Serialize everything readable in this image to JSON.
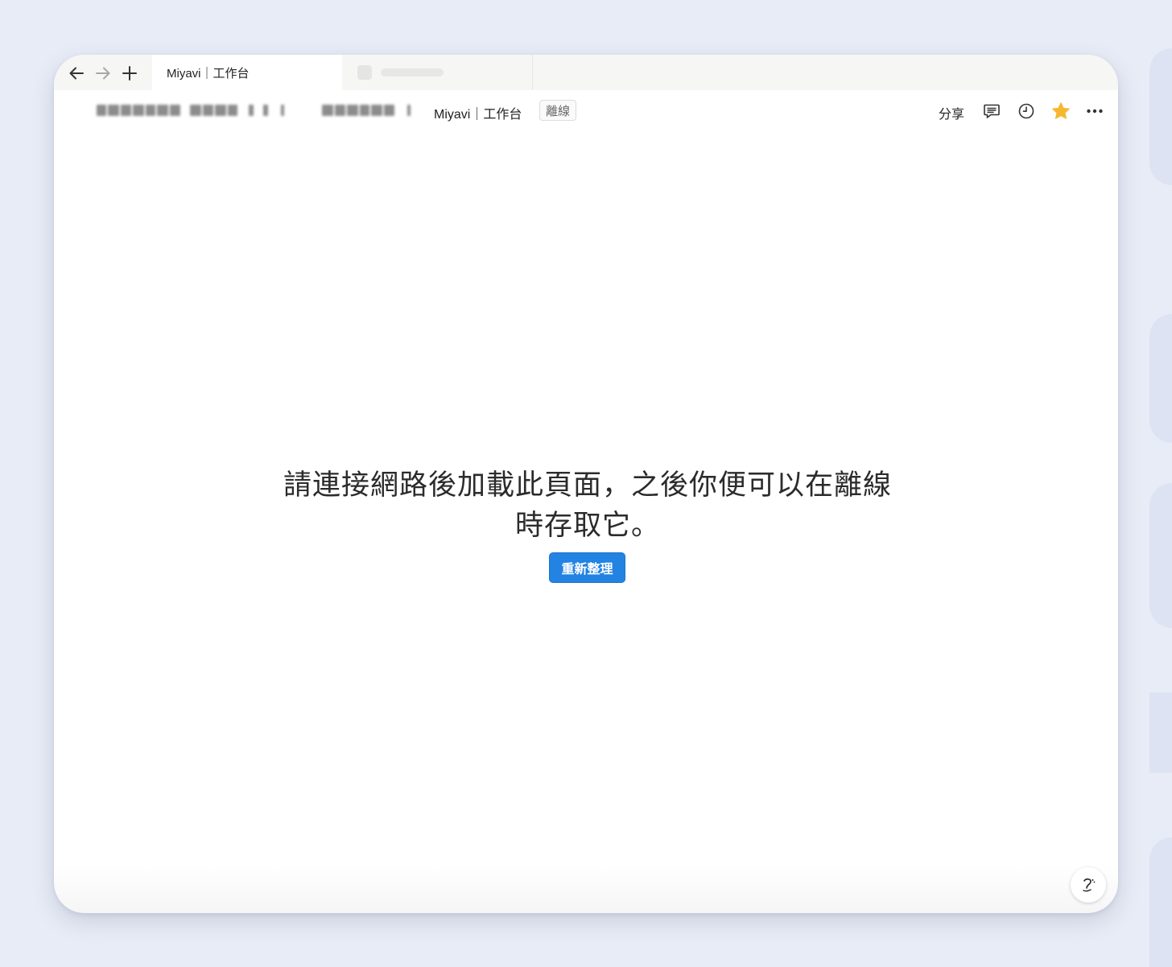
{
  "tab": {
    "active_title": "Miyavi｜工作台"
  },
  "toolbar": {
    "current_page": "Miyavi｜工作台",
    "offline_badge": "離線",
    "share_label": "分享"
  },
  "main": {
    "message": "請連接網路後加載此頁面，之後你便可以在離線時存取它。",
    "reload_label": "重新整理"
  },
  "icons": {
    "back": "arrow-left-icon",
    "forward": "arrow-right-icon",
    "new_tab": "plus-icon",
    "comments": "comment-icon",
    "history": "clock-icon",
    "favorite": "star-icon",
    "more": "more-dots-icon",
    "help": "help-icon"
  },
  "colors": {
    "accent": "#2383e2",
    "star": "#f5b82e",
    "background": "#e8ecf6"
  }
}
